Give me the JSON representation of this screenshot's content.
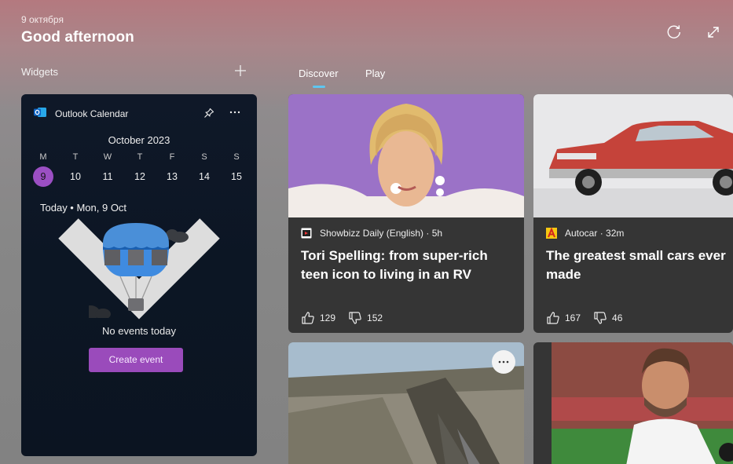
{
  "header": {
    "date": "9 октября",
    "greeting": "Good afternoon"
  },
  "widgets": {
    "label": "Widgets"
  },
  "tabs": [
    {
      "label": "Discover",
      "active": true
    },
    {
      "label": "Play",
      "active": false
    }
  ],
  "calendar": {
    "title": "Outlook Calendar",
    "month": "October 2023",
    "weekdays": [
      "M",
      "T",
      "W",
      "T",
      "F",
      "S",
      "S"
    ],
    "dates": [
      "9",
      "10",
      "11",
      "12",
      "13",
      "14",
      "15"
    ],
    "selected_date": "9",
    "today_label": "Today • Mon, 9 Oct",
    "empty_message": "No events today",
    "create_button": "Create event",
    "accent_color": "#9a4bbb"
  },
  "news": [
    {
      "source": "Showbizz Daily (English) · 5h",
      "headline": "Tori Spelling: from super-rich teen icon to living in an RV",
      "likes": "129",
      "dislikes": "152"
    },
    {
      "source": "Autocar · 32m",
      "headline": "The greatest small cars ever made",
      "likes": "167",
      "dislikes": "46"
    }
  ]
}
